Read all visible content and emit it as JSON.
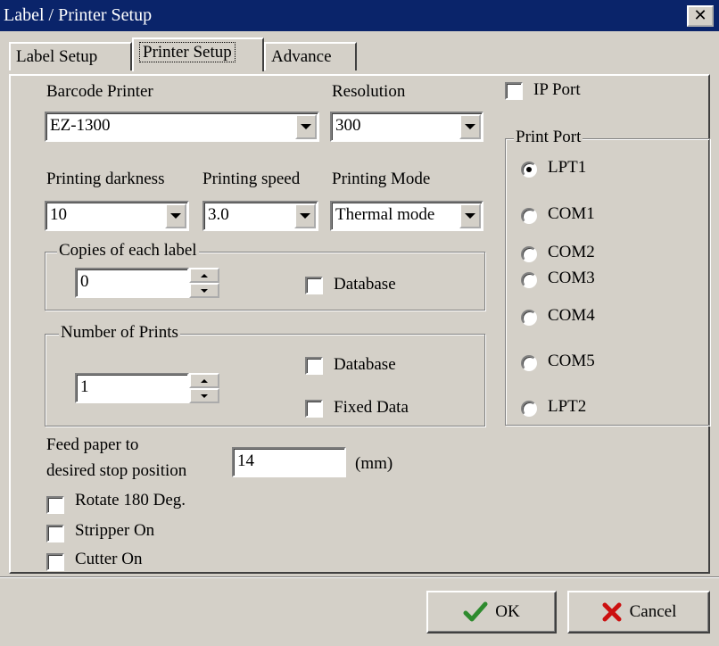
{
  "window": {
    "title": "Label / Printer Setup",
    "close_icon": "close-icon"
  },
  "tabs": [
    {
      "label": "Label Setup"
    },
    {
      "label": "Printer Setup"
    },
    {
      "label": "Advance"
    }
  ],
  "printer": {
    "barcode_printer_label": "Barcode Printer",
    "barcode_printer_value": "EZ-1300",
    "resolution_label": "Resolution",
    "resolution_value": "300",
    "darkness_label": "Printing darkness",
    "darkness_value": "10",
    "speed_label": "Printing speed",
    "speed_value": "3.0",
    "mode_label": "Printing Mode",
    "mode_value": "Thermal mode"
  },
  "copies": {
    "legend": "Copies of each label",
    "value": "0",
    "database_label": "Database"
  },
  "prints": {
    "legend": "Number of Prints",
    "value": "1",
    "database_label": "Database",
    "fixed_label": "Fixed Data"
  },
  "feed": {
    "label_line1": "Feed paper to",
    "label_line2": "desired stop position",
    "value": "14",
    "unit": "(mm)"
  },
  "options": {
    "rotate_label": "Rotate 180 Deg.",
    "stripper_label": "Stripper On",
    "cutter_label": "Cutter On"
  },
  "ip_port_label": "IP Port",
  "print_port": {
    "legend": "Print Port",
    "selected": "LPT1",
    "options": [
      "LPT1",
      "COM1",
      "COM2",
      "COM3",
      "COM4",
      "COM5",
      "LPT2"
    ]
  },
  "buttons": {
    "ok_label": "OK",
    "cancel_label": "Cancel"
  },
  "colors": {
    "titlebar": "#0a246a",
    "face": "#d4d0c8",
    "ok_check": "#2e8b2e",
    "cancel_x": "#cc1010"
  }
}
